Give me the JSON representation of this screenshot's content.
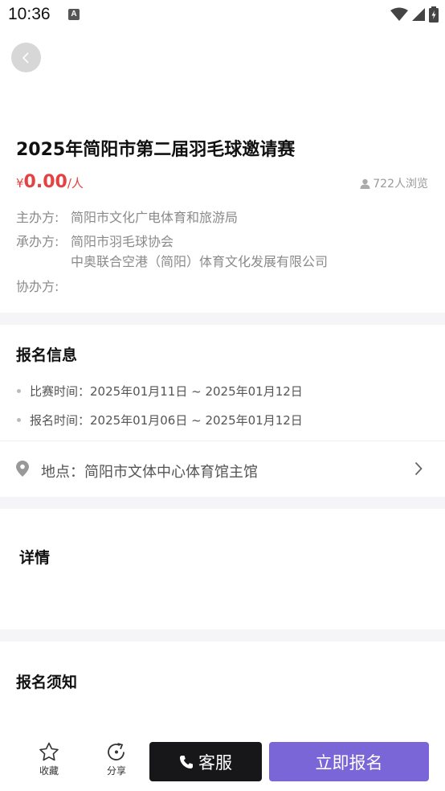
{
  "status_bar": {
    "time": "10:36",
    "notification_glyph": "A"
  },
  "event": {
    "title": "2025年简阳市第二届羽毛球邀请赛",
    "price_currency": "¥",
    "price_amount": "0.00",
    "price_unit": "/人",
    "views": "722人浏览"
  },
  "organizers": {
    "host_label": "主办方:",
    "host_value": "简阳市文化广电体育和旅游局",
    "organizer_label": "承办方:",
    "organizer_values": [
      "简阳市羽毛球协会",
      "中奥联合空港（简阳）体育文化发展有限公司"
    ],
    "co_label": "协办方:",
    "co_value": ""
  },
  "registration_info": {
    "title": "报名信息",
    "match_time": "比赛时间：2025年01月11日 ~ 2025年01月12日",
    "signup_time": "报名时间：2025年01月06日 ~ 2025年01月12日"
  },
  "location": {
    "label": "地点：简阳市文体中心体育馆主馆"
  },
  "details": {
    "title": "详情"
  },
  "notice": {
    "title": "报名须知"
  },
  "bottom_bar": {
    "favorite_label": "收藏",
    "share_label": "分享",
    "service_label": "客服",
    "signup_label": "立即报名"
  },
  "colors": {
    "price": "#e54141",
    "primary": "#7a66d6",
    "dark_button": "#17171a"
  },
  "icons": [
    "back-icon",
    "wifi-icon",
    "signal-icon",
    "battery-icon",
    "user-icon",
    "location-pin-icon",
    "chevron-right-icon",
    "star-icon",
    "share-icon",
    "phone-icon"
  ]
}
